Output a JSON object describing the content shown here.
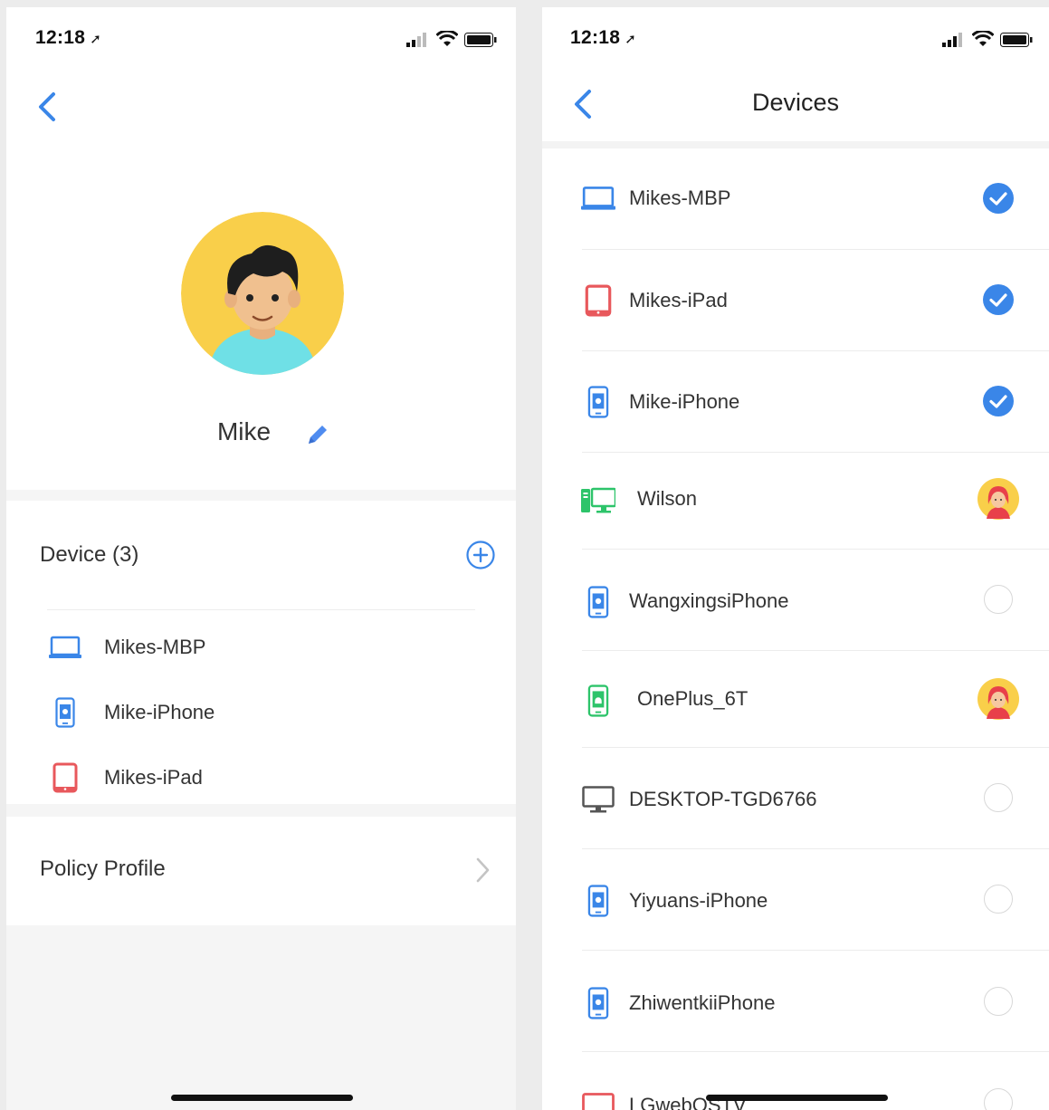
{
  "left": {
    "status": {
      "time": "12:18",
      "location_icon": "location-arrow-icon"
    },
    "back_icon": "chevron-left-icon",
    "user": {
      "name": "Mike",
      "avatar": "cartoon-boy-avatar",
      "edit_icon": "pencil-icon"
    },
    "devices_section": {
      "title": "Device (3)",
      "add_icon": "plus-circle-icon",
      "items": [
        {
          "label": "Mikes-MBP",
          "icon": "laptop-icon"
        },
        {
          "label": "Mike-iPhone",
          "icon": "iphone-icon"
        },
        {
          "label": "Mikes-iPad",
          "icon": "ipad-icon"
        }
      ]
    },
    "policy": {
      "label": "Policy Profile",
      "icon": "chevron-right-icon"
    }
  },
  "right": {
    "status": {
      "time": "12:18",
      "location_icon": "location-arrow-icon"
    },
    "back_icon": "chevron-left-icon",
    "title": "Devices",
    "devices": [
      {
        "label": "Mikes-MBP",
        "icon": "laptop-icon",
        "state": "checked"
      },
      {
        "label": "Mikes-iPad",
        "icon": "ipad-icon",
        "state": "checked"
      },
      {
        "label": "Mike-iPhone",
        "icon": "iphone-icon",
        "state": "checked"
      },
      {
        "label": "Wilson",
        "icon": "desktop-pc-icon",
        "state": "assigned-avatar"
      },
      {
        "label": "WangxingsiPhone",
        "icon": "iphone-icon",
        "state": "unchecked"
      },
      {
        "label": "OnePlus_6T",
        "icon": "android-phone-icon",
        "state": "assigned-avatar"
      },
      {
        "label": "DESKTOP-TGD6766",
        "icon": "monitor-icon",
        "state": "unchecked"
      },
      {
        "label": "Yiyuans-iPhone",
        "icon": "iphone-icon",
        "state": "unchecked"
      },
      {
        "label": "ZhiwentkiiPhone",
        "icon": "iphone-icon",
        "state": "unchecked"
      },
      {
        "label": "LGwebOSTV",
        "icon": "tv-icon",
        "state": "unchecked"
      }
    ]
  },
  "colors": {
    "accent": "#3a86e8",
    "ipad_red": "#e8585c",
    "android_green": "#2dc46a",
    "text": "#333333",
    "divider": "#ececec"
  }
}
